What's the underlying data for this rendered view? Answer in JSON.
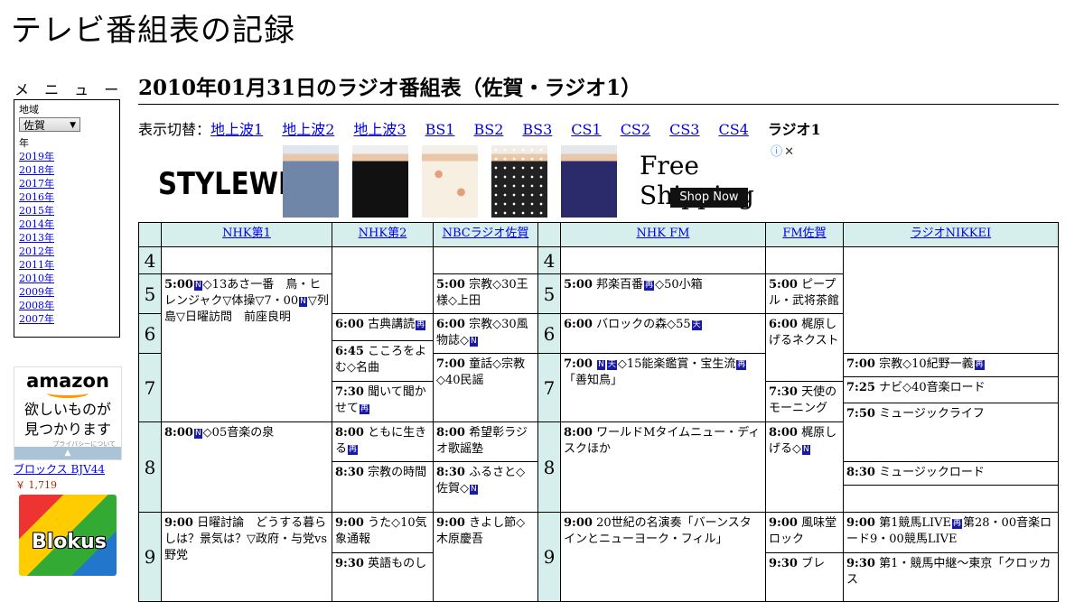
{
  "site": {
    "title": "テレビ番組表の記録"
  },
  "menu": {
    "heading": "メ ニ ュ ー",
    "region_label": "地域",
    "region_value": "佐賀",
    "year_label": "年",
    "years": [
      "2019年",
      "2018年",
      "2017年",
      "2016年",
      "2015年",
      "2014年",
      "2013年",
      "2012年",
      "2011年",
      "2010年",
      "2009年",
      "2008年",
      "2007年"
    ]
  },
  "sidebar_ad": {
    "logo": "amazon",
    "catch_line1": "欲しいものが",
    "catch_line2": "見つかります",
    "privacy": "プライバシーについて",
    "product_name": "ブロックス BJV44",
    "product_price": "￥ 1,719",
    "product_image_text": "Blokus"
  },
  "page": {
    "heading": "2010年01月31日のラジオ番組表（佐賀・ラジオ1）"
  },
  "switcher": {
    "label": "表示切替：",
    "links": [
      "地上波1",
      "地上波2",
      "地上波3",
      "BS1",
      "BS2",
      "BS3",
      "CS1",
      "CS2",
      "CS3",
      "CS4"
    ],
    "current": "ラジオ1"
  },
  "banner_ad": {
    "brand": "STYLEWE",
    "headline": "Free Shipping",
    "cta": "Shop Now",
    "adchoices_i": "ⓘ",
    "adchoices_x": "✕"
  },
  "schedule": {
    "channels": [
      "NHK第1",
      "NHK第2",
      "NBCラジオ佐賀",
      "NHK FM",
      "FM佐賀",
      "ラジオNIKKEI"
    ],
    "hours": [
      "4",
      "5",
      "6",
      "7",
      "8",
      "9"
    ],
    "programs": {
      "nhk1": [
        {
          "time": "5:00",
          "pre": "",
          "title": "◇13あさ一番　鳥・ヒレンジャク▽体操▽7・00",
          "post": "▽列島▽日曜訪問　前座良明",
          "icons": [
            "N",
            "N"
          ]
        },
        {
          "time": "8:00",
          "title": "◇05音楽の泉",
          "icons": [
            "N"
          ]
        },
        {
          "time": "9:00",
          "title": "日曜討論　どうする暮らしは？景気は？▽政府・与党vs野党",
          "icons": []
        }
      ],
      "nhk2": [
        {
          "time": "6:00",
          "title": "古典講読",
          "icons": [
            "再"
          ]
        },
        {
          "time": "6:45",
          "title": "こころをよむ◇名曲",
          "icons": []
        },
        {
          "time": "7:30",
          "title": "聞いて聞かせて",
          "icons": [
            "再"
          ]
        },
        {
          "time": "8:00",
          "title": "ともに生きる",
          "icons": [
            "再"
          ]
        },
        {
          "time": "8:30",
          "title": "宗教の時間",
          "icons": []
        },
        {
          "time": "9:00",
          "title": "うた◇10気象通報",
          "icons": []
        },
        {
          "time": "9:30",
          "title": "英語ものし",
          "icons": []
        }
      ],
      "nbc": [
        {
          "time": "5:00",
          "title": "宗教◇30王様◇上田",
          "icons": []
        },
        {
          "time": "6:00",
          "title": "宗教◇30風物誌◇",
          "icons": [
            "N"
          ]
        },
        {
          "time": "7:00",
          "title": "童話◇宗教◇40民謡",
          "icons": []
        },
        {
          "time": "8:00",
          "title": "希望彰ラジオ歌謡塾",
          "icons": []
        },
        {
          "time": "8:30",
          "title": "ふるさと◇佐賀◇",
          "icons": [
            "N"
          ]
        },
        {
          "time": "9:00",
          "title": "きよし節◇木原慶吾",
          "icons": []
        }
      ],
      "nhkfm": [
        {
          "time": "5:00",
          "title": "邦楽百番",
          "post": "◇50小箱",
          "icons": [
            "再"
          ]
        },
        {
          "time": "6:00",
          "title": "バロックの森◇55",
          "icons": [
            "天"
          ]
        },
        {
          "time": "7:00",
          "title": "◇15能楽鑑賞・宝生流",
          "post": "「善知鳥」",
          "icons": [
            "N",
            "天",
            "再"
          ]
        },
        {
          "time": "8:00",
          "title": "ワールドMタイムニュー・ディスクほか",
          "icons": []
        },
        {
          "time": "9:00",
          "title": "20世紀の名演奏「バーンスタインとニューヨーク・フィル」",
          "icons": []
        }
      ],
      "fmsaga": [
        {
          "time": "5:00",
          "title": "ピープル・武将茶館",
          "icons": []
        },
        {
          "time": "6:00",
          "title": "梶原しげるネクスト",
          "icons": []
        },
        {
          "time": "7:30",
          "title": "天使のモーニング",
          "icons": []
        },
        {
          "time": "8:00",
          "title": "梶原しげる◇",
          "icons": [
            "N"
          ]
        },
        {
          "time": "9:00",
          "title": "風味堂ロック",
          "icons": []
        },
        {
          "time": "9:30",
          "title": "ブレ",
          "icons": []
        }
      ],
      "nikkei": [
        {
          "time": "7:00",
          "title": "宗教◇10紀野一義",
          "icons": [
            "再"
          ]
        },
        {
          "time": "7:25",
          "title": "ナビ◇40音楽ロード",
          "icons": []
        },
        {
          "time": "7:50",
          "title": "ミュージックライフ",
          "icons": []
        },
        {
          "time": "8:30",
          "title": "ミュージックロード",
          "icons": []
        },
        {
          "time": "9:00",
          "title": "第1競馬LIVE",
          "post": "第28・00音楽ロード9・00競馬LIVE",
          "icons": [
            "再"
          ]
        },
        {
          "time": "9:30",
          "title": "第1・競馬中継～東京「クロッカス",
          "icons": []
        }
      ]
    }
  },
  "colors": {
    "header_bg": "#d6eeec",
    "link": "#0000ee",
    "icon_bg": "#1a1aa8"
  }
}
